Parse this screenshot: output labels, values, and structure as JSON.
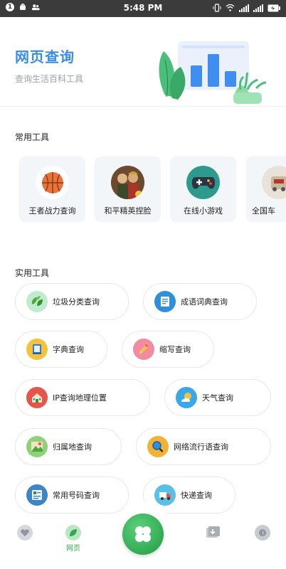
{
  "status_bar": {
    "notification_badge": "1",
    "time": "5:48 PM"
  },
  "header": {
    "title": "网页查询",
    "subtitle": "查询生活百科工具",
    "illustration_icon": "bar-chart-plant-illustration"
  },
  "common_tools": {
    "section_title": "常用工具",
    "items": [
      {
        "label": "王者战力查询",
        "icon": "basketball-icon"
      },
      {
        "label": "和平精英捏脸",
        "icon": "game-character-avatar"
      },
      {
        "label": "在线小游戏",
        "icon": "gamepad-icon"
      },
      {
        "label": "全国车",
        "icon": "car-icon"
      }
    ]
  },
  "practical_tools": {
    "section_title": "实用工具",
    "items": [
      {
        "label": "垃圾分类查询",
        "icon": "recycle-leaves-icon",
        "color": "#bfeccf"
      },
      {
        "label": "成语词典查询",
        "icon": "document-icon",
        "color": "#2f8fd8"
      },
      {
        "label": "字典查询",
        "icon": "book-icon",
        "color": "#f5c33b"
      },
      {
        "label": "缩写查询",
        "icon": "pencil-icon",
        "color": "#f28aa0"
      },
      {
        "label": "IP查询地理位置",
        "icon": "house-icon",
        "color": "#e8534a"
      },
      {
        "label": "天气查询",
        "icon": "sun-cloud-icon",
        "color": "#3aa8e8"
      },
      {
        "label": "归属地查询",
        "icon": "landscape-icon",
        "color": "#8fd07a"
      },
      {
        "label": "网络流行语查询",
        "icon": "magnifier-icon",
        "color": "#f2b233"
      },
      {
        "label": "常用号码查询",
        "icon": "contacts-icon",
        "color": "#3c86c8"
      },
      {
        "label": "快递查询",
        "icon": "truck-icon",
        "color": "#5cc0e6"
      }
    ]
  },
  "bottom_nav": {
    "items": [
      {
        "label": "",
        "icon": "heart-icon"
      },
      {
        "label": "网页",
        "icon": "leaf-icon"
      },
      {
        "label": "",
        "icon": "clover-icon"
      },
      {
        "label": "",
        "icon": "inbox-icon"
      },
      {
        "label": "",
        "icon": "profile-icon"
      }
    ],
    "accent": "#36a84a"
  }
}
